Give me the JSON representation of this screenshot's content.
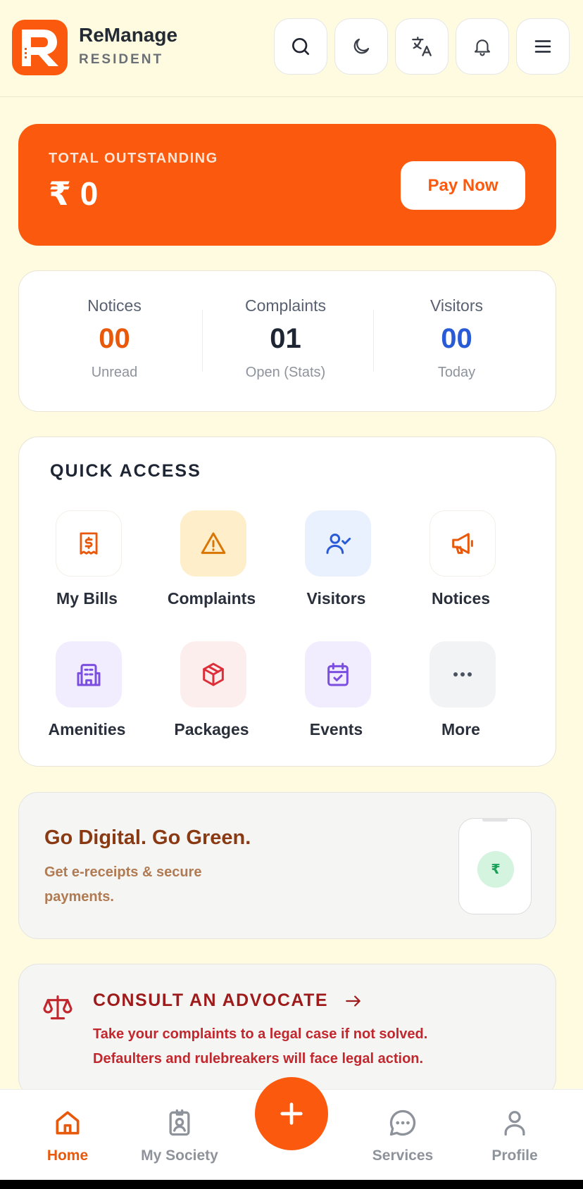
{
  "header": {
    "app_name": "ReManage",
    "app_role": "RESIDENT",
    "icons": [
      "search-icon",
      "moon-icon",
      "translate-icon",
      "bell-icon",
      "menu-icon"
    ]
  },
  "outstanding": {
    "label": "TOTAL OUTSTANDING",
    "value": "₹ 0",
    "pay_button": "Pay Now"
  },
  "stats": [
    {
      "title": "Notices",
      "value": "00",
      "sub": "Unread",
      "color": "#e8590c"
    },
    {
      "title": "Complaints",
      "value": "01",
      "sub": "Open (Stats)",
      "color": "#1e2533"
    },
    {
      "title": "Visitors",
      "value": "00",
      "sub": "Today",
      "color": "#2a5bd7"
    }
  ],
  "quick_access": {
    "title": "QUICK ACCESS",
    "items": [
      {
        "label": "My Bills",
        "icon": "bill-icon"
      },
      {
        "label": "Complaints",
        "icon": "warning-icon"
      },
      {
        "label": "Visitors",
        "icon": "user-check-icon"
      },
      {
        "label": "Notices",
        "icon": "megaphone-icon"
      },
      {
        "label": "Amenities",
        "icon": "building-icon"
      },
      {
        "label": "Packages",
        "icon": "package-icon"
      },
      {
        "label": "Events",
        "icon": "calendar-icon"
      },
      {
        "label": "More",
        "icon": "more-icon"
      }
    ]
  },
  "green_banner": {
    "title": "Go Digital. Go Green.",
    "subtitle": "Get e-receipts & secure payments.",
    "coin_symbol": "₹"
  },
  "advocate": {
    "title": "CONSULT AN ADVOCATE",
    "line1": "Take your complaints to a legal case if not solved.",
    "line2": "Defaulters and rulebreakers will face legal action."
  },
  "bottom_nav": {
    "items": [
      {
        "label": "Home",
        "active": true
      },
      {
        "label": "My Society",
        "active": false
      },
      {
        "label": "Services",
        "active": false
      },
      {
        "label": "Profile",
        "active": false
      }
    ]
  },
  "colors": {
    "brand": "#fb5a0e",
    "background": "#fefbe0"
  }
}
